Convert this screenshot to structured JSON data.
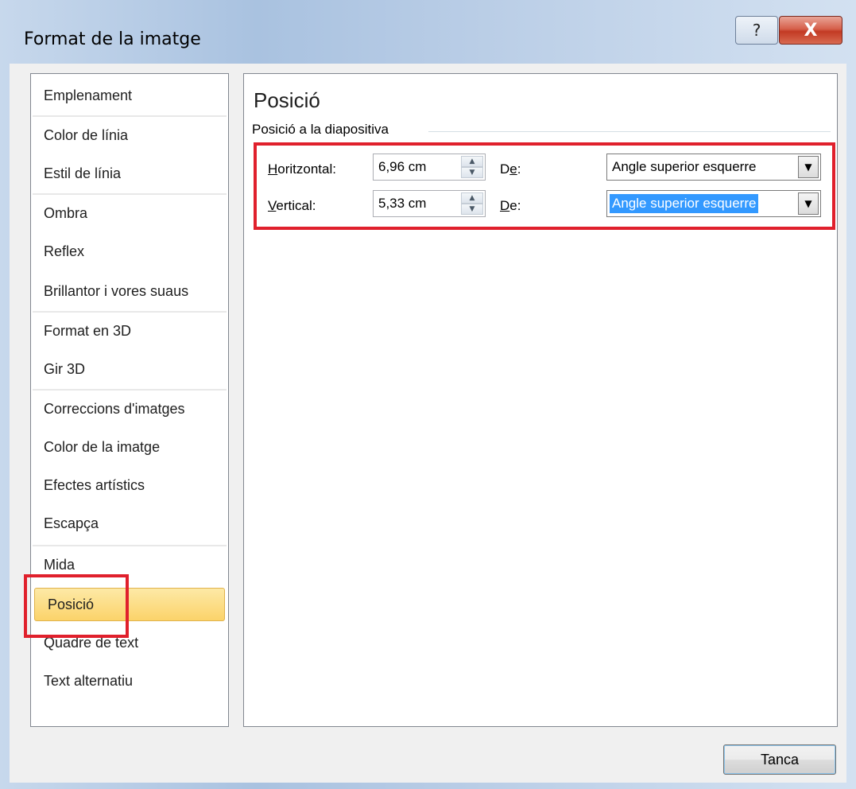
{
  "window": {
    "title": "Format de la imatge",
    "help_label": "?",
    "close_label": "X"
  },
  "sidebar": {
    "items": [
      {
        "label": "Emplenament"
      },
      {
        "label": "Color de línia"
      },
      {
        "label": "Estil de línia"
      },
      {
        "label": "Ombra"
      },
      {
        "label": "Reflex"
      },
      {
        "label": "Brillantor i vores suaus"
      },
      {
        "label": "Format en 3D"
      },
      {
        "label": "Gir 3D"
      },
      {
        "label": "Correccions d'imatges"
      },
      {
        "label": "Color de la imatge"
      },
      {
        "label": "Efectes artístics"
      },
      {
        "label": "Escapça"
      },
      {
        "label": "Mida"
      },
      {
        "label": "Posició"
      },
      {
        "label": "Quadre de text"
      },
      {
        "label": "Text alternatiu"
      }
    ],
    "selected": "Posició"
  },
  "panel": {
    "title": "Posició",
    "group_label": "Posició a la diapositiva",
    "horizontal": {
      "label_underlined": "H",
      "label_rest": "oritzontal:",
      "value": "6,96 cm",
      "from_label_first": "D",
      "from_label_underlined": "e",
      "from_label_rest": ":",
      "from_value": "Angle superior esquerre"
    },
    "vertical": {
      "label_underlined": "V",
      "label_rest": "ertical:",
      "value": "5,33 cm",
      "from_label_underlined": "D",
      "from_label_rest": "e:",
      "from_value": "Angle superior esquerre"
    }
  },
  "footer": {
    "close_button": "Tanca"
  },
  "colors": {
    "highlight": "#e0202c",
    "selection": "#3399ff",
    "selected_item": "#fbd36a"
  },
  "icons": {
    "spin_up": "▲",
    "spin_down": "▼",
    "dropdown_arrow": "▼"
  }
}
